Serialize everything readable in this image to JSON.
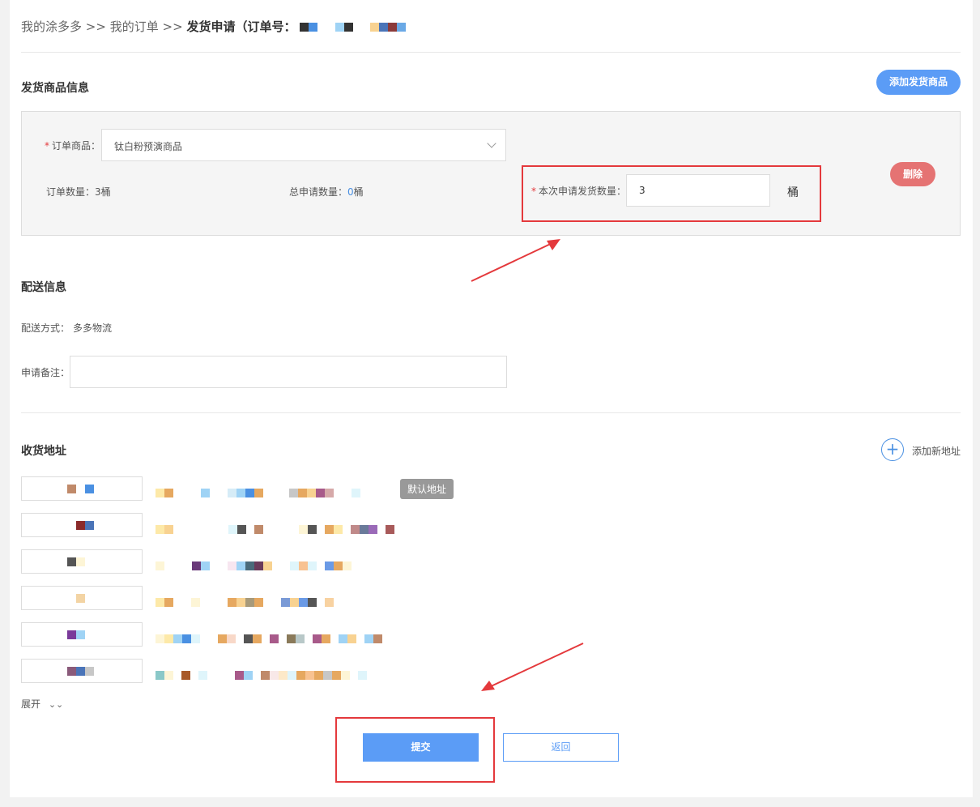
{
  "breadcrumb": {
    "home": "我的涂多多",
    "sep1": ">>",
    "orders": "我的订单",
    "sep2": ">>",
    "current": "发货申请（订单号："
  },
  "goods_section": {
    "title": "发货商品信息",
    "add_button": "添加发货商品",
    "product_label": "订单商品：",
    "product_value": "钛白粉预演商品",
    "order_qty_label": "订单数量：",
    "order_qty_value": "3桶",
    "total_apply_label": "总申请数量：",
    "total_apply_value": "0",
    "total_apply_unit": "桶",
    "this_apply_label": "本次申请发货数量：",
    "this_apply_value": "3",
    "unit": "桶",
    "delete_button": "删除"
  },
  "delivery_section": {
    "title": "配送信息",
    "method_label": "配送方式：",
    "method_value": "多多物流",
    "remark_label": "申请备注：",
    "remark_value": ""
  },
  "address_section": {
    "title": "收货地址",
    "add_address": "添加新地址",
    "default_badge": "默认地址",
    "expand": "展开"
  },
  "actions": {
    "submit": "提交",
    "back": "返回"
  },
  "colors": {
    "accent_blue": "#5b9cf6",
    "delete_red": "#e57373",
    "highlight_red": "#e4393c"
  }
}
